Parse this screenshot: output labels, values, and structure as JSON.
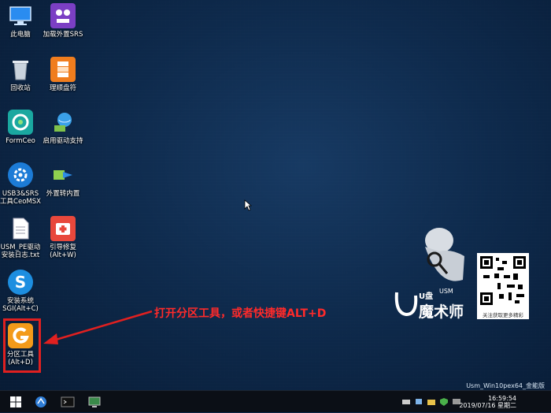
{
  "desktop_icons": [
    {
      "label": "此电脑",
      "icon": "computer-icon"
    },
    {
      "label": "加载外置SRS",
      "icon": "srs-icon"
    },
    {
      "label": "回收站",
      "icon": "recycle-bin-icon"
    },
    {
      "label": "理顺盘符",
      "icon": "drive-letter-icon"
    },
    {
      "label": "FormCeo",
      "icon": "formceo-icon"
    },
    {
      "label": "启用驱动支持",
      "icon": "driver-support-icon"
    },
    {
      "label": "USB3&SRS",
      "label2": "工具CeoMSX",
      "icon": "usb-tool-icon"
    },
    {
      "label": "外置转内置",
      "icon": "external-to-internal-icon"
    },
    {
      "label": "USM_PE驱动",
      "label2": "安装日志.txt",
      "icon": "text-file-icon"
    },
    {
      "label": "引导修复",
      "label2": "(Alt+W)",
      "icon": "boot-repair-icon"
    },
    {
      "label": "安装系统",
      "label2": "SGI(Alt+C)",
      "icon": "install-system-icon"
    },
    {
      "label": "分区工具",
      "label2": "(Alt+D)",
      "icon": "partition-tool-icon"
    }
  ],
  "annotation": {
    "text": "打开分区工具，或者快捷键ALT+D",
    "color": "#ff2a2a"
  },
  "brand": {
    "logo_text": "魔术师",
    "logo_u": "U盘",
    "logo_usm": "USM",
    "qr_caption": "关注获取更多精彩"
  },
  "watermark": {
    "os_name": "Usm_Win10pex64_金能版",
    "time": "16:59:54",
    "date": "2019/07/16 星期二"
  },
  "taskbar": {
    "items": [
      "start-icon",
      "network-icon",
      "terminal-icon",
      "monitor-icon"
    ]
  },
  "colors": {
    "desktop": "#0e2a4c",
    "taskbar": "#0b0f16",
    "highlight": "#e02020"
  }
}
